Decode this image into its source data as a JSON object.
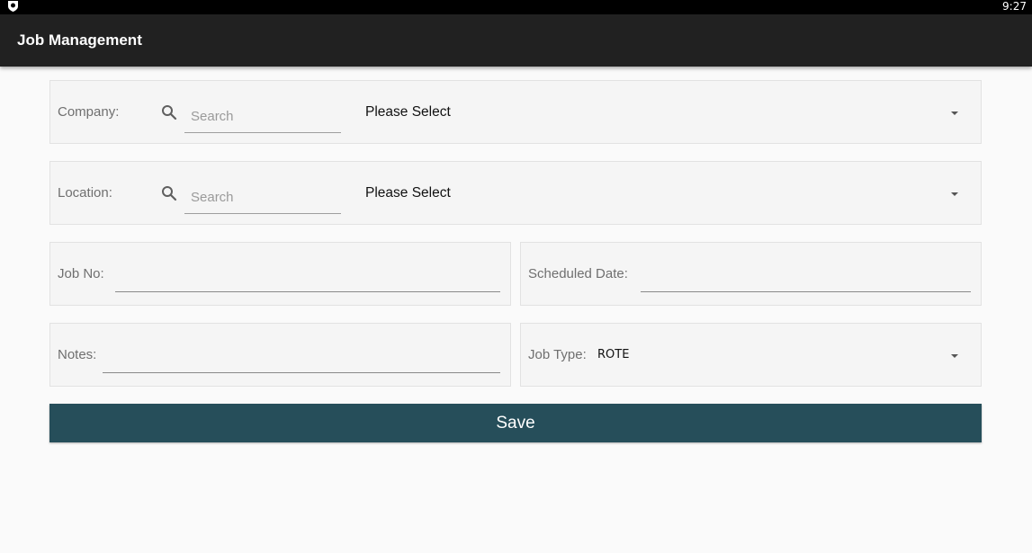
{
  "status_bar": {
    "time": "9:27",
    "left_icon": "shield-icon"
  },
  "app_bar": {
    "title": "Job Management"
  },
  "form": {
    "company": {
      "label": "Company:",
      "search_placeholder": "Search",
      "select_value": "Please Select",
      "icon": "search-icon"
    },
    "location": {
      "label": "Location:",
      "search_placeholder": "Search",
      "select_value": "Please Select",
      "icon": "search-icon"
    },
    "job_no": {
      "label": "Job No:",
      "value": ""
    },
    "scheduled_date": {
      "label": "Scheduled Date:",
      "value": ""
    },
    "notes": {
      "label": "Notes:",
      "value": ""
    },
    "job_type": {
      "label": "Job Type:",
      "select_value": "ROTE"
    }
  },
  "actions": {
    "save_label": "Save"
  },
  "colors": {
    "app_bar": "#212121",
    "save_button": "#264e5a",
    "background": "#fafafa"
  }
}
